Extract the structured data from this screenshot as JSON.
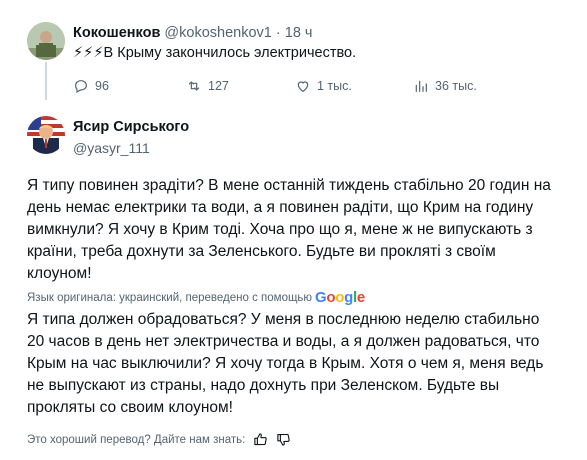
{
  "reply_parent": {
    "display_name": "Кокошенков",
    "handle": "@kokoshenkov1",
    "separator": "·",
    "time": "18 ч",
    "text": "⚡⚡⚡В Крыму закончилось электричество.",
    "actions": {
      "replies": "96",
      "retweets": "127",
      "likes": "1 тыс.",
      "views": "36 тыс."
    }
  },
  "main_tweet": {
    "display_name": "Ясир Сирського",
    "handle": "@yasyr_111",
    "original_lines": [
      "Я типу повинен зрадіти? В мене останній тиждень стабільно 20 годин на",
      "день немає електрики та води, а я повинен радіти, що Крим на годину",
      "вимкнули? Я хочу в Крим тоді. Хоча про що я, мене ж не випускають з",
      "країни, треба дохнути за Зеленського. Будьте ви прокляті з своїм",
      "клоуном!"
    ],
    "translation_note": "Язык оригинала: украинский, переведено с помощью",
    "translation_provider": "Google",
    "translated_lines": [
      "Я типа должен обрадоваться? У меня в последнюю неделю стабильно",
      "20 часов в день нет электричества и воды, а я должен радоваться, что",
      "Крым на час выключили? Я хочу тогда в Крым. Хотя о чем я, меня ведь",
      "не выпускают из страны, надо дохнуть при Зеленском. Будьте вы",
      "прокляты со своим клоуном!"
    ],
    "rate_prompt": "Это хороший перевод? Дайте нам знать:"
  },
  "colors": {
    "text_primary": "#0f1419",
    "text_secondary": "#536471",
    "thread_line": "#cfd9de"
  }
}
